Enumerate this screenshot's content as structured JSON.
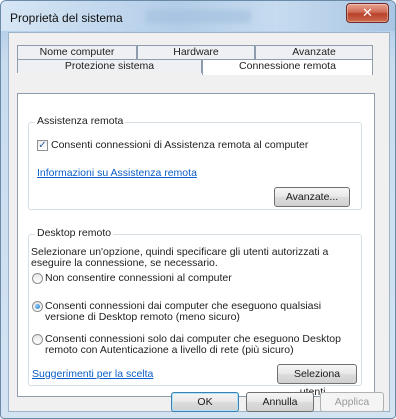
{
  "window": {
    "title": "Proprietà del sistema",
    "close_glyph": "✕"
  },
  "tabs_top": [
    "Nome computer",
    "Hardware",
    "Avanzate"
  ],
  "tabs_bottom": [
    "Protezione sistema",
    "Connessione remota"
  ],
  "assistance": {
    "title": "Assistenza remota",
    "checkbox_label": "Consenti connessioni di Assistenza remota al computer",
    "checkbox_checked": true,
    "info_link": "Informazioni su Assistenza remota",
    "advanced_button": "Avanzate..."
  },
  "desktop": {
    "title": "Desktop remoto",
    "description_line1": "Selezionare un'opzione, quindi specificare gli utenti autorizzati a",
    "description_line2": "eseguire la connessione, se necessario.",
    "option1": "Non consentire connessioni al computer",
    "option2_line1": "Consenti connessioni dai computer che eseguono qualsiasi",
    "option2_line2": "versione di Desktop remoto (meno sicuro)",
    "option3_line1": "Consenti connessioni solo dai computer che eseguono Desktop",
    "option3_line2": "remoto con Autenticazione a livello di rete (più sicuro)",
    "selected_option": 2,
    "help_link": "Suggerimenti per la scelta",
    "select_users_button": "Seleziona utenti..."
  },
  "footer": {
    "ok": "OK",
    "cancel": "Annulla",
    "apply": "Applica"
  }
}
